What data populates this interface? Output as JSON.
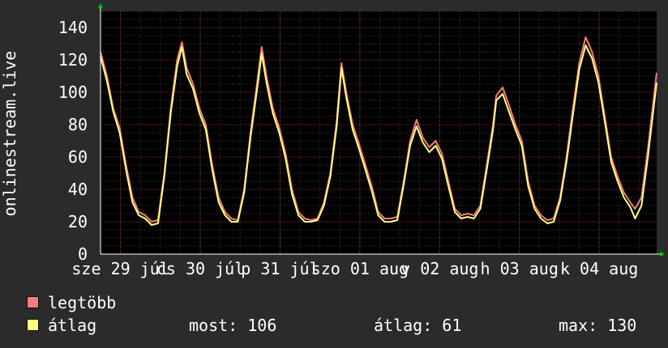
{
  "chart_data": {
    "type": "line",
    "ylabel": "onlinestream.live",
    "ylim": [
      0,
      150
    ],
    "y_ticks": [
      "0",
      "20",
      "40",
      "60",
      "80",
      "100",
      "120",
      "140"
    ],
    "y_tick_values": [
      0,
      20,
      40,
      60,
      80,
      100,
      120,
      140
    ],
    "x_tick_labels": [
      "sze 29 júl",
      "cs 30 júl",
      "p 31 júl",
      "szo 01 aug",
      "v 02 aug",
      "h 03 aug",
      "k 04 aug"
    ],
    "x_tick_positions": [
      0.5,
      1.5,
      2.5,
      3.5,
      4.5,
      5.5,
      6.5
    ],
    "x_range": [
      0.25,
      7.22
    ],
    "grid": true,
    "legend_position": "bottom-left",
    "series": [
      {
        "name": "legtöbb",
        "color": "#f47c7c",
        "points": [
          [
            0.25,
            125
          ],
          [
            0.33,
            110
          ],
          [
            0.41,
            90
          ],
          [
            0.49,
            78
          ],
          [
            0.57,
            55
          ],
          [
            0.65,
            35
          ],
          [
            0.73,
            26
          ],
          [
            0.81,
            24
          ],
          [
            0.89,
            20
          ],
          [
            0.97,
            21
          ],
          [
            1.05,
            50
          ],
          [
            1.13,
            90
          ],
          [
            1.21,
            120
          ],
          [
            1.27,
            131
          ],
          [
            1.33,
            115
          ],
          [
            1.41,
            105
          ],
          [
            1.49,
            90
          ],
          [
            1.57,
            80
          ],
          [
            1.65,
            55
          ],
          [
            1.73,
            35
          ],
          [
            1.81,
            26
          ],
          [
            1.89,
            22
          ],
          [
            1.97,
            21
          ],
          [
            2.05,
            40
          ],
          [
            2.13,
            75
          ],
          [
            2.21,
            105
          ],
          [
            2.27,
            128
          ],
          [
            2.33,
            110
          ],
          [
            2.41,
            90
          ],
          [
            2.49,
            78
          ],
          [
            2.57,
            62
          ],
          [
            2.65,
            40
          ],
          [
            2.73,
            26
          ],
          [
            2.81,
            22
          ],
          [
            2.89,
            21
          ],
          [
            2.97,
            22
          ],
          [
            3.05,
            32
          ],
          [
            3.13,
            50
          ],
          [
            3.21,
            82
          ],
          [
            3.27,
            118
          ],
          [
            3.33,
            100
          ],
          [
            3.41,
            80
          ],
          [
            3.49,
            68
          ],
          [
            3.57,
            55
          ],
          [
            3.65,
            42
          ],
          [
            3.73,
            26
          ],
          [
            3.81,
            22
          ],
          [
            3.89,
            22
          ],
          [
            3.97,
            23
          ],
          [
            4.05,
            45
          ],
          [
            4.13,
            70
          ],
          [
            4.21,
            83
          ],
          [
            4.29,
            72
          ],
          [
            4.37,
            66
          ],
          [
            4.45,
            70
          ],
          [
            4.53,
            62
          ],
          [
            4.61,
            45
          ],
          [
            4.69,
            28
          ],
          [
            4.77,
            24
          ],
          [
            4.85,
            25
          ],
          [
            4.93,
            24
          ],
          [
            5.01,
            30
          ],
          [
            5.09,
            55
          ],
          [
            5.17,
            80
          ],
          [
            5.21,
            98
          ],
          [
            5.29,
            103
          ],
          [
            5.37,
            92
          ],
          [
            5.45,
            80
          ],
          [
            5.53,
            70
          ],
          [
            5.61,
            45
          ],
          [
            5.69,
            30
          ],
          [
            5.77,
            24
          ],
          [
            5.85,
            21
          ],
          [
            5.93,
            22
          ],
          [
            6.01,
            35
          ],
          [
            6.09,
            60
          ],
          [
            6.17,
            90
          ],
          [
            6.25,
            118
          ],
          [
            6.33,
            134
          ],
          [
            6.41,
            125
          ],
          [
            6.49,
            110
          ],
          [
            6.57,
            85
          ],
          [
            6.65,
            60
          ],
          [
            6.73,
            48
          ],
          [
            6.81,
            38
          ],
          [
            6.89,
            32
          ],
          [
            6.95,
            28
          ],
          [
            7.03,
            35
          ],
          [
            7.11,
            65
          ],
          [
            7.22,
            112
          ]
        ]
      },
      {
        "name": "átlag",
        "color": "#ffff80",
        "points": [
          [
            0.25,
            122
          ],
          [
            0.33,
            107
          ],
          [
            0.41,
            88
          ],
          [
            0.49,
            75
          ],
          [
            0.57,
            52
          ],
          [
            0.65,
            32
          ],
          [
            0.73,
            24
          ],
          [
            0.81,
            22
          ],
          [
            0.89,
            18
          ],
          [
            0.97,
            19
          ],
          [
            1.05,
            48
          ],
          [
            1.13,
            87
          ],
          [
            1.21,
            116
          ],
          [
            1.27,
            128
          ],
          [
            1.33,
            111
          ],
          [
            1.41,
            102
          ],
          [
            1.49,
            87
          ],
          [
            1.57,
            77
          ],
          [
            1.65,
            52
          ],
          [
            1.73,
            32
          ],
          [
            1.81,
            24
          ],
          [
            1.89,
            20
          ],
          [
            1.97,
            20
          ],
          [
            2.05,
            38
          ],
          [
            2.13,
            72
          ],
          [
            2.21,
            101
          ],
          [
            2.27,
            124
          ],
          [
            2.33,
            106
          ],
          [
            2.41,
            87
          ],
          [
            2.49,
            75
          ],
          [
            2.57,
            59
          ],
          [
            2.65,
            37
          ],
          [
            2.73,
            24
          ],
          [
            2.81,
            20
          ],
          [
            2.89,
            20
          ],
          [
            2.97,
            21
          ],
          [
            3.05,
            30
          ],
          [
            3.13,
            48
          ],
          [
            3.21,
            79
          ],
          [
            3.27,
            115
          ],
          [
            3.33,
            97
          ],
          [
            3.41,
            77
          ],
          [
            3.49,
            65
          ],
          [
            3.57,
            52
          ],
          [
            3.65,
            39
          ],
          [
            3.73,
            24
          ],
          [
            3.81,
            20
          ],
          [
            3.89,
            20
          ],
          [
            3.97,
            21
          ],
          [
            4.05,
            43
          ],
          [
            4.13,
            67
          ],
          [
            4.21,
            79
          ],
          [
            4.29,
            69
          ],
          [
            4.37,
            63
          ],
          [
            4.45,
            67
          ],
          [
            4.53,
            59
          ],
          [
            4.61,
            42
          ],
          [
            4.69,
            26
          ],
          [
            4.77,
            22
          ],
          [
            4.85,
            23
          ],
          [
            4.93,
            22
          ],
          [
            5.01,
            28
          ],
          [
            5.09,
            52
          ],
          [
            5.17,
            77
          ],
          [
            5.21,
            95
          ],
          [
            5.29,
            99
          ],
          [
            5.37,
            88
          ],
          [
            5.45,
            77
          ],
          [
            5.53,
            67
          ],
          [
            5.61,
            42
          ],
          [
            5.69,
            28
          ],
          [
            5.77,
            22
          ],
          [
            5.85,
            19
          ],
          [
            5.93,
            20
          ],
          [
            6.01,
            33
          ],
          [
            6.09,
            57
          ],
          [
            6.17,
            86
          ],
          [
            6.25,
            114
          ],
          [
            6.33,
            129
          ],
          [
            6.41,
            121
          ],
          [
            6.49,
            106
          ],
          [
            6.57,
            82
          ],
          [
            6.65,
            57
          ],
          [
            6.73,
            45
          ],
          [
            6.81,
            35
          ],
          [
            6.89,
            29
          ],
          [
            6.95,
            22
          ],
          [
            7.03,
            30
          ],
          [
            7.11,
            60
          ],
          [
            7.22,
            106
          ]
        ]
      }
    ]
  },
  "legend": {
    "items": [
      {
        "label": "legtöbb",
        "color": "#f47c7c"
      },
      {
        "label": "átlag",
        "color": "#ffff80"
      }
    ],
    "stats": {
      "current": "most: 106",
      "average": "átlag: 61",
      "max": "max: 130"
    }
  },
  "colors": {
    "background": "#2b2b2b",
    "plot_background": "#000000",
    "grid_major": "#7a2a2a",
    "grid_minor": "#3a3a3a",
    "axis_arrow": "#00cc00",
    "text": "#ffffff"
  }
}
